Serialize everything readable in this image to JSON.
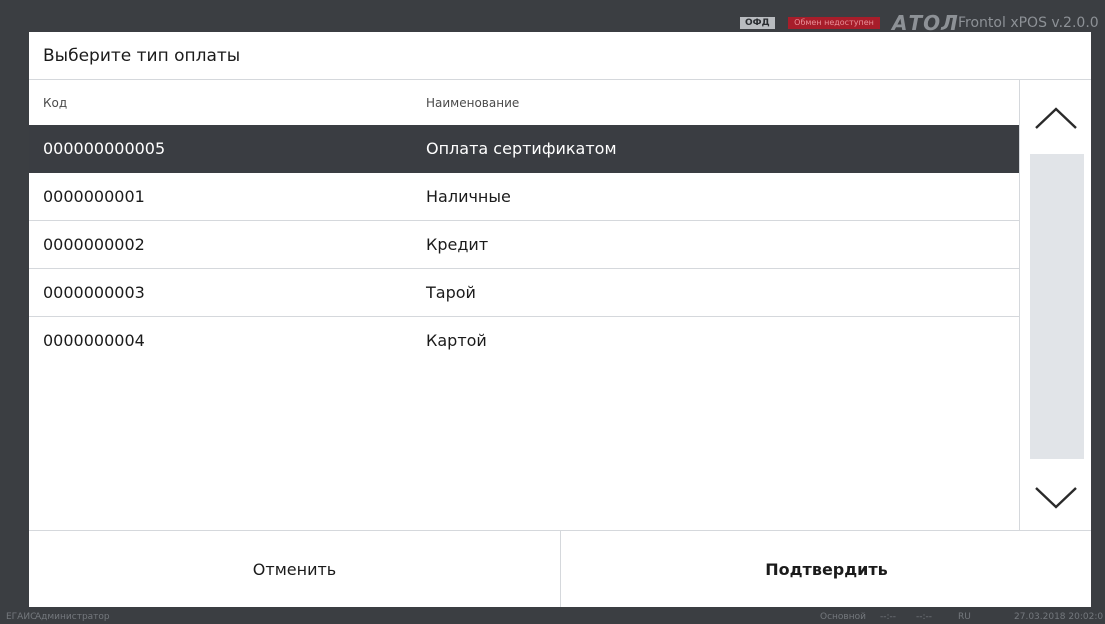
{
  "topbar": {
    "ofd_label": "ОФД",
    "exchange_status": "Обмен недоступен",
    "brand": "АТОЛ",
    "version": "Frontol xPOS v.2.0.0"
  },
  "dialog": {
    "title": "Выберите тип оплаты",
    "columns": {
      "code": "Код",
      "name": "Наименование"
    },
    "rows": [
      {
        "code": "000000000005",
        "name": "Оплата сертификатом",
        "selected": true
      },
      {
        "code": "0000000001",
        "name": "Наличные",
        "selected": false
      },
      {
        "code": "0000000002",
        "name": "Кредит",
        "selected": false
      },
      {
        "code": "0000000003",
        "name": "Тарой",
        "selected": false
      },
      {
        "code": "0000000004",
        "name": "Картой",
        "selected": false
      }
    ],
    "scroll": {
      "up_icon": "chevron-up-icon",
      "down_icon": "chevron-down-icon"
    },
    "cancel_label": "Отменить",
    "confirm_label": "Подтвердить"
  },
  "statusbar": {
    "egais": "ЕГАИС",
    "user": "Администратор",
    "mode": "Основной",
    "field1": "--:--",
    "field2": "--:--",
    "lang": "RU",
    "datetime": "27.03.2018 20:02:0"
  },
  "colors": {
    "background": "#3b3e42",
    "selected_row": "#3a3d42",
    "error_badge": "#a71d2a",
    "scroll_track": "#e1e4e8"
  }
}
